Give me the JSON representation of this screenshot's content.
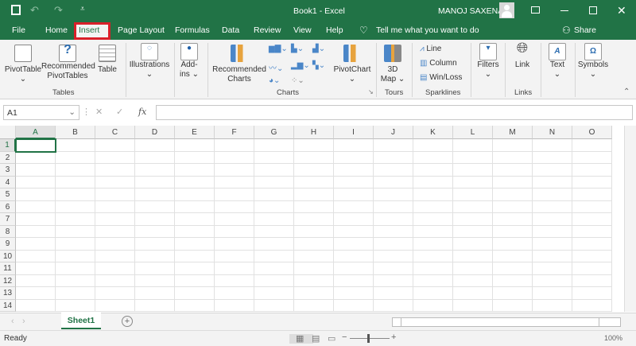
{
  "title": {
    "doc": "Book1  -  Excel",
    "user": "MANOJ SAXENA"
  },
  "tabs": [
    "File",
    "Home",
    "Insert",
    "Page Layout",
    "Formulas",
    "Data",
    "Review",
    "View",
    "Help"
  ],
  "tell_me": "Tell me what you want to do",
  "share": "Share",
  "ribbon": {
    "pivottable": "PivotTable",
    "rec_pivot_1": "Recommended",
    "rec_pivot_2": "PivotTables",
    "table": "Table",
    "group_tables": "Tables",
    "illustrations": "Illustrations",
    "addins_1": "Add-",
    "addins_2": "ins",
    "rec_charts_1": "Recommended",
    "rec_charts_2": "Charts",
    "pivotchart": "PivotChart",
    "group_charts": "Charts",
    "map_1": "3D",
    "map_2": "Map",
    "group_tours": "Tours",
    "line": "Line",
    "column": "Column",
    "winloss": "Win/Loss",
    "group_sparklines": "Sparklines",
    "filters": "Filters",
    "link": "Link",
    "group_links": "Links",
    "text": "Text",
    "symbols": "Symbols"
  },
  "formula_bar": {
    "name_box": "A1",
    "fx": "fx",
    "value": ""
  },
  "columns": [
    "A",
    "B",
    "C",
    "D",
    "E",
    "F",
    "G",
    "H",
    "I",
    "J",
    "K",
    "L",
    "M",
    "N",
    "O"
  ],
  "rows": [
    "1",
    "2",
    "3",
    "4",
    "5",
    "6",
    "7",
    "8",
    "9",
    "10",
    "11",
    "12",
    "13",
    "14"
  ],
  "sheet_tab": "Sheet1",
  "status": {
    "ready": "Ready",
    "zoom": "100%"
  },
  "colors": {
    "brand": "#217346",
    "highlight": "#d9202a"
  }
}
